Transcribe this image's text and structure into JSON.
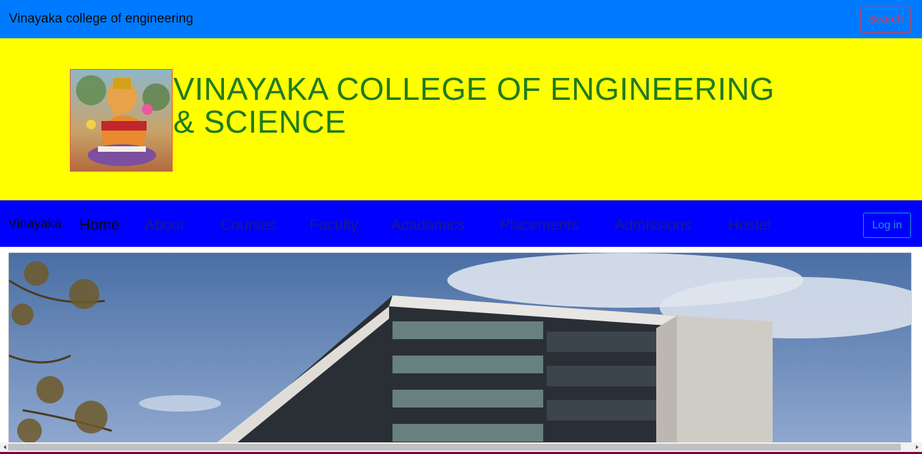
{
  "topbar": {
    "brand": "Vinayaka college of engineering",
    "search_label": "Search",
    "background": "#007bff",
    "search_color": "#dc3545"
  },
  "header": {
    "title": "VINAYAKA COLLEGE OF ENGINEERING & SCIENCE",
    "logo_icon": "ganesha-image",
    "background": "#ffff00",
    "title_color": "#1f7a1f"
  },
  "navbar": {
    "brand": "Vinayaka",
    "items": [
      {
        "label": "Home"
      },
      {
        "label": "About"
      },
      {
        "label": "Courses"
      },
      {
        "label": "Faculty"
      },
      {
        "label": "Acadamics"
      },
      {
        "label": "Placements"
      },
      {
        "label": "Admissions"
      },
      {
        "label": "Hostel"
      }
    ],
    "login_label": "Log in",
    "background": "#0000ff",
    "login_color": "#17a2b8"
  },
  "hero": {
    "image_icon": "college-building-photo"
  }
}
